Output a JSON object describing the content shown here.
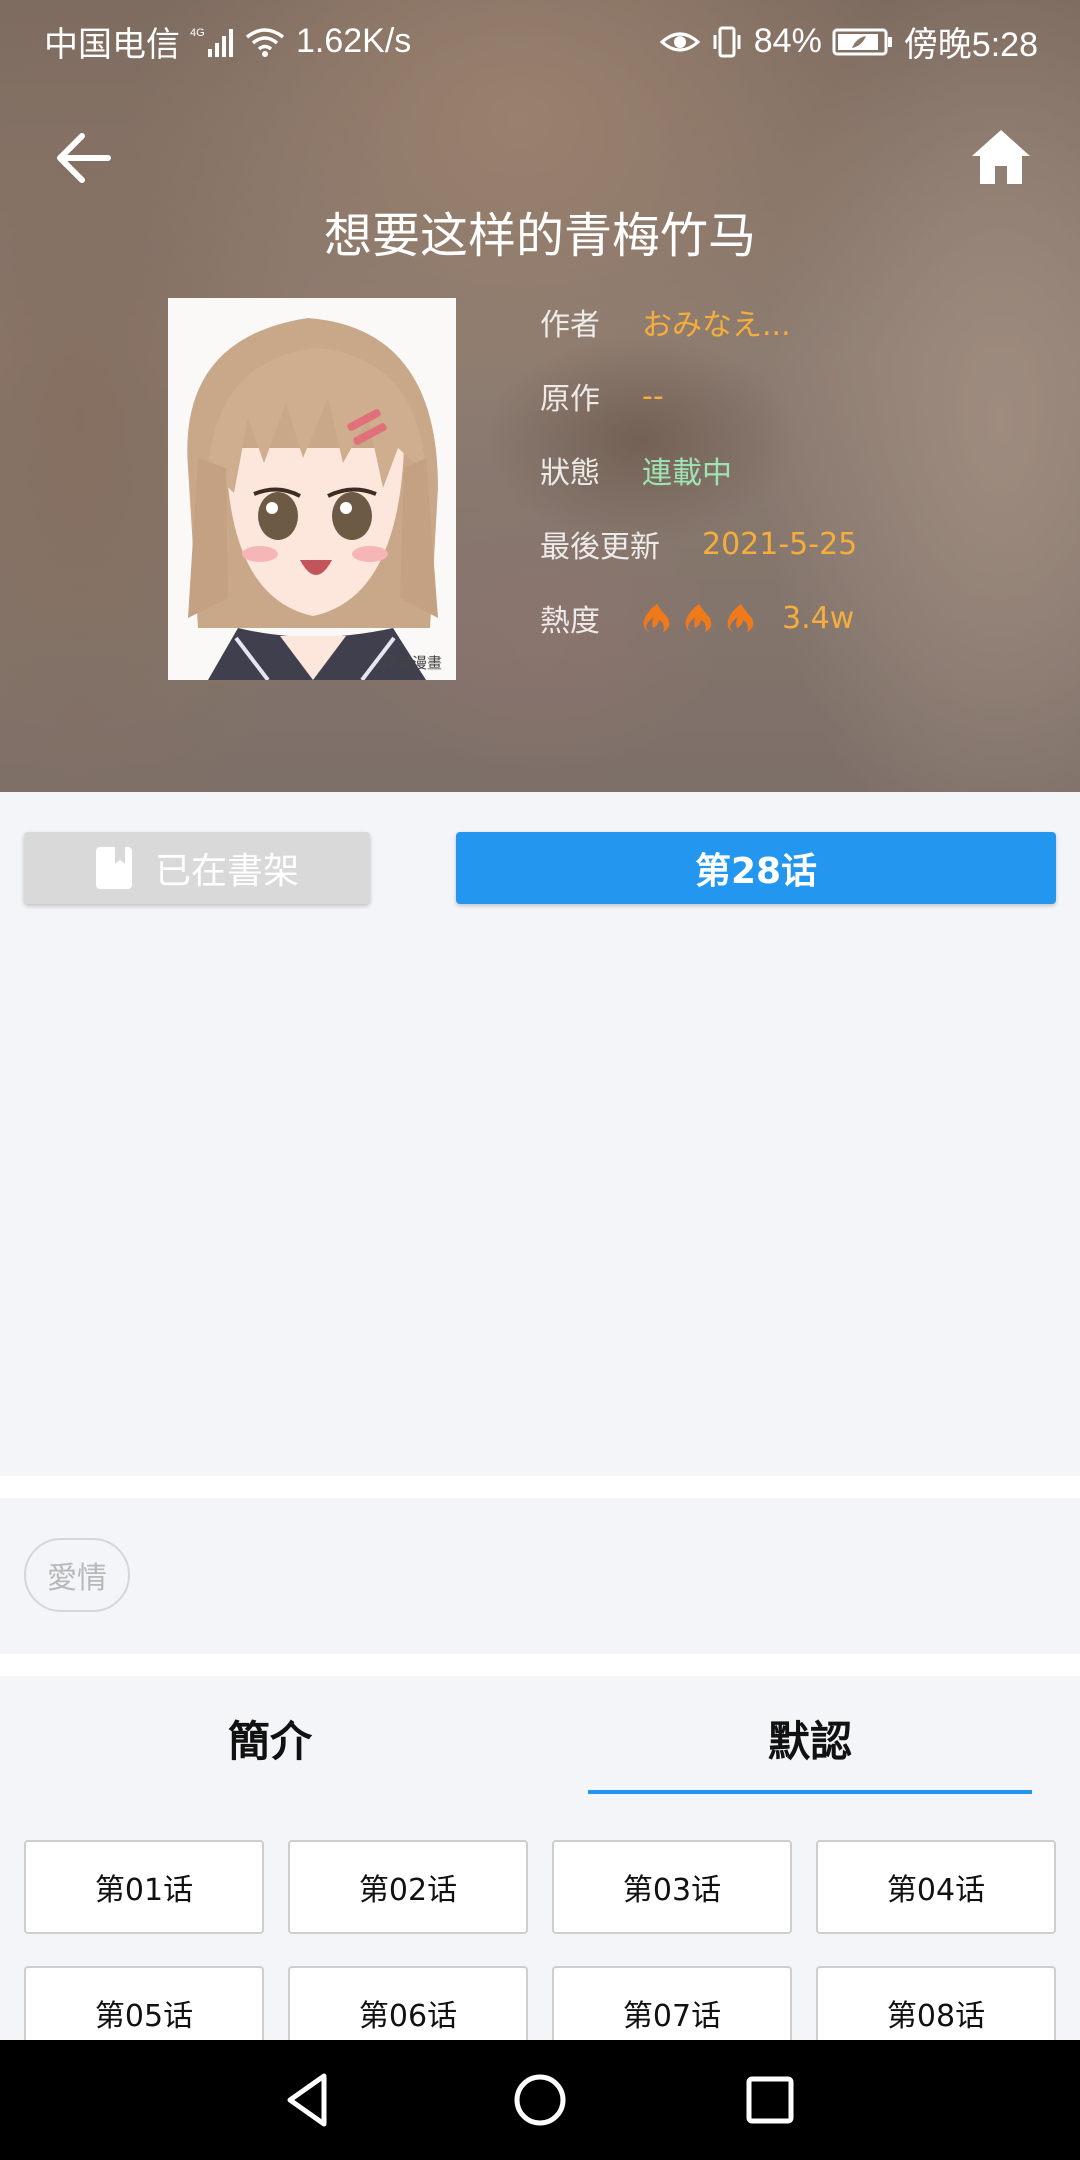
{
  "status_bar": {
    "carrier": "中国电信",
    "network": "4G",
    "speed": "1.62K/s",
    "battery": "84%",
    "time": "傍晚5:28"
  },
  "header": {
    "title": "想要这样的青梅竹马",
    "back_icon": "arrow-left-icon",
    "home_icon": "home-icon"
  },
  "cover": {
    "watermark": "拷貝漫畫"
  },
  "info": {
    "author_label": "作者",
    "author_value": "おみなえ...",
    "original_label": "原作",
    "original_value": "--",
    "status_label": "狀態",
    "status_value": "連載中",
    "updated_label": "最後更新",
    "updated_value": "2021-5-25",
    "heat_label": "熱度",
    "heat_value": "3.4w",
    "heat_icon_count": 3
  },
  "actions": {
    "shelf_label": "已在書架",
    "read_label": "第28话"
  },
  "tags": [
    "愛情"
  ],
  "tabs": {
    "intro": "簡介",
    "default": "默認",
    "selected": "default"
  },
  "chapters": [
    "第01话",
    "第02话",
    "第03话",
    "第04话",
    "第05话",
    "第06话",
    "第07话",
    "第08话"
  ],
  "colors": {
    "accent": "#2396ef",
    "orange": "#f5ad3c",
    "green": "#9ee3b4",
    "flame": "#f07a1a"
  }
}
